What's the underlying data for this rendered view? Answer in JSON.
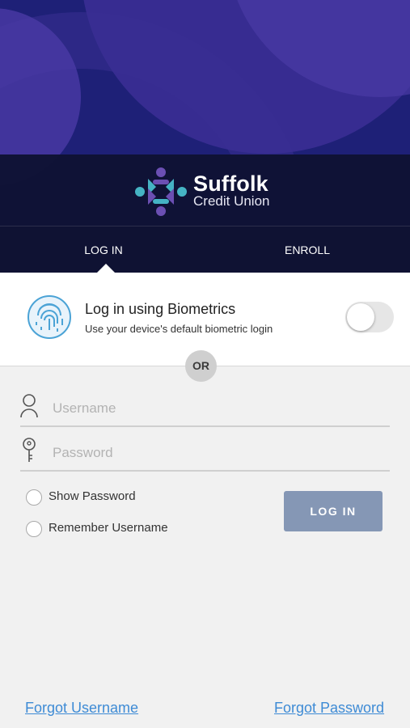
{
  "brand": {
    "name": "Suffolk",
    "subtitle": "Credit Union",
    "colors": {
      "hero_background": "#1e2077",
      "brand_bar": "#0f1233",
      "logo_teal": "#45b3c4",
      "logo_purple": "#6b4fb3"
    }
  },
  "tabs": [
    {
      "label": "LOG IN",
      "active": true
    },
    {
      "label": "ENROLL",
      "active": false
    }
  ],
  "biometrics": {
    "title": "Log in using Biometrics",
    "subtitle": "Use your device's default biometric login",
    "toggle_on": false,
    "icon": "fingerprint-icon"
  },
  "divider_label": "OR",
  "form": {
    "username_placeholder": "Username",
    "username_icon": "user-icon",
    "password_placeholder": "Password",
    "password_icon": "key-icon",
    "show_password_label": "Show Password",
    "remember_username_label": "Remember Username",
    "login_button": "LOG IN",
    "login_button_color": "#8597b5"
  },
  "links": {
    "forgot_username": "Forgot Username",
    "forgot_password": "Forgot Password",
    "color": "#3e8bd5"
  }
}
